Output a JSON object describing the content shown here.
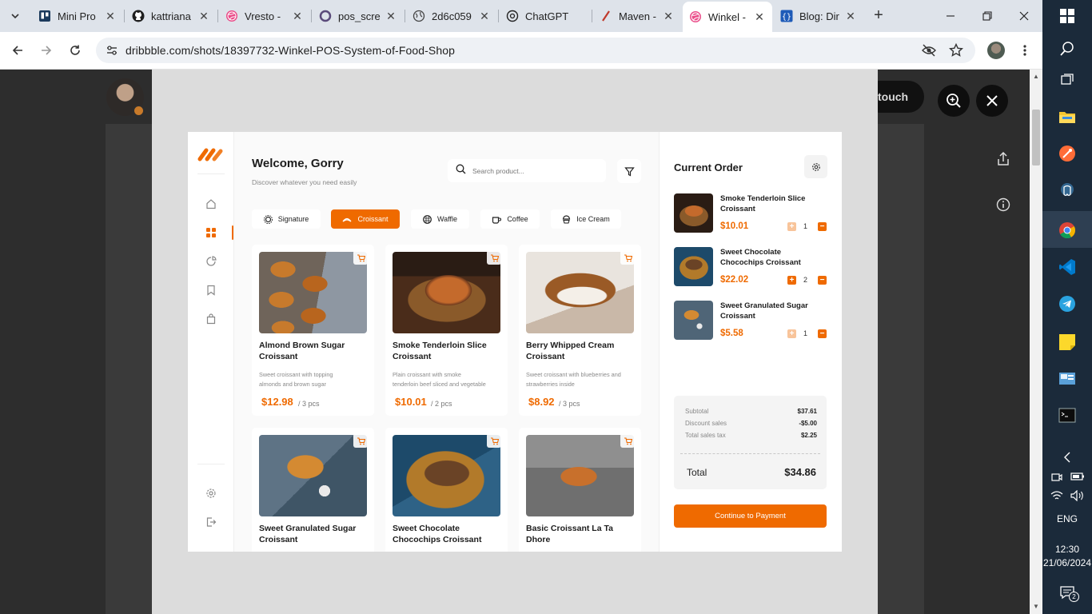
{
  "browser": {
    "tabs": [
      {
        "title": "Mini Pro"
      },
      {
        "title": "kattriana"
      },
      {
        "title": "Vresto -"
      },
      {
        "title": "pos_scre"
      },
      {
        "title": "2d6c059"
      },
      {
        "title": "ChatGPT"
      },
      {
        "title": "Maven -"
      },
      {
        "title": "Winkel -",
        "active": true
      },
      {
        "title": "Blog: Dir"
      }
    ],
    "url": "dribbble.com/shots/18397732-Winkel-POS-System-of-Food-Shop"
  },
  "page": {
    "touch_label": "touch"
  },
  "app": {
    "welcome": "Welcome, Gorry",
    "subtitle": "Discover whatever you need easily",
    "search_placeholder": "Search product...",
    "categories": [
      {
        "label": "Signature",
        "icon": "signature-icon"
      },
      {
        "label": "Croissant",
        "icon": "croissant-icon",
        "active": true
      },
      {
        "label": "Waffle",
        "icon": "waffle-icon"
      },
      {
        "label": "Coffee",
        "icon": "coffee-icon"
      },
      {
        "label": "Ice Cream",
        "icon": "ice-cream-icon"
      }
    ],
    "products": [
      {
        "name": "Almond Brown Sugar Croissant",
        "desc": "Sweet croissant with  topping almonds and brown sugar",
        "price": "$12.98",
        "unit": "/ 3 pcs"
      },
      {
        "name": "Smoke Tenderloin Slice Croissant",
        "desc": "Plain croissant with smoke tenderloin beef sliced and vegetable",
        "price": "$10.01",
        "unit": "/ 2 pcs"
      },
      {
        "name": "Berry Whipped Cream Croissant",
        "desc": "Sweet croissant with blueberries and strawberries inside",
        "price": "$8.92",
        "unit": "/ 3 pcs"
      },
      {
        "name": "Sweet Granulated Sugar Croissant"
      },
      {
        "name": "Sweet Chocolate Chocochips Croissant"
      },
      {
        "name": "Basic Croissant La Ta Dhore"
      }
    ],
    "order": {
      "title": "Current Order",
      "items": [
        {
          "name": "Smoke Tenderloin Slice Croissant",
          "price": "$10.01",
          "qty": "1"
        },
        {
          "name": "Sweet Chocolate Chocochips Croissant",
          "price": "$22.02",
          "qty": "2"
        },
        {
          "name": "Sweet Granulated Sugar Croissant",
          "price": "$5.58",
          "qty": "1"
        }
      ],
      "subtotal_label": "Subtotal",
      "subtotal": "$37.61",
      "discount_label": "Discount sales",
      "discount": "-$5.00",
      "tax_label": "Total sales tax",
      "tax": "$2.25",
      "total_label": "Total",
      "total": "$34.86",
      "pay_label": "Continue to Payment"
    }
  },
  "taskbar": {
    "language": "ENG",
    "time": "12:30",
    "date": "21/06/2024",
    "notification_count": "2"
  },
  "colors": {
    "accent": "#ef6a00",
    "taskbar": "#1b2a3a"
  }
}
